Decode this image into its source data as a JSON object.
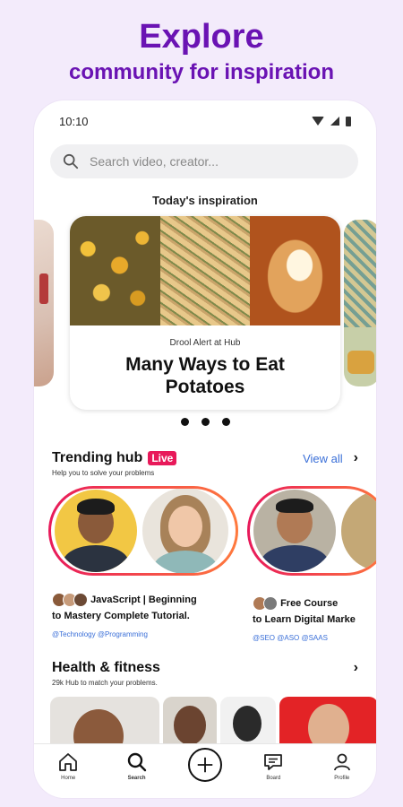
{
  "hero": {
    "title": "Explore",
    "subtitle": "community for inspiration",
    "color": "#6a13b3"
  },
  "status_bar": {
    "time": "10:10",
    "icons": [
      "wifi-icon",
      "signal-icon",
      "battery-icon"
    ]
  },
  "search": {
    "placeholder": "Search video, creator..."
  },
  "inspiration": {
    "section_title": "Today's inspiration",
    "card": {
      "eyebrow": "Drool Alert at Hub",
      "title": "Many Ways to Eat Potatoes"
    },
    "page_count": 3
  },
  "trending": {
    "title": "Trending hub",
    "live_badge": "Live",
    "subtitle": "Help you to solve your problems",
    "view_all": "View all",
    "items": [
      {
        "title": "JavaScript | Beginning to Mastery Complete Tutorial.",
        "title_line1": "JavaScript | Beginning",
        "title_line2": "to Mastery Complete Tutorial.",
        "tags": "@Technology @Programming"
      },
      {
        "title": "Free Course to Learn Digital Marke",
        "title_line1": "Free Course",
        "title_line2": "to Learn Digital Marke",
        "tags": "@SEO @ASO @SAAS"
      }
    ]
  },
  "health": {
    "title": "Health & fitness",
    "subtitle": "29k Hub to match your problems."
  },
  "nav": {
    "items": [
      {
        "label": "Home",
        "icon": "home-icon"
      },
      {
        "label": "Search",
        "icon": "search-icon"
      },
      {
        "label": "",
        "icon": "plus-icon"
      },
      {
        "label": "Board",
        "icon": "chat-icon"
      },
      {
        "label": "Profile",
        "icon": "profile-icon"
      }
    ]
  },
  "colors": {
    "live": "#e8195a",
    "link": "#3a6fd8",
    "ring_start": "#e8195a",
    "ring_end": "#ff7a3d"
  }
}
